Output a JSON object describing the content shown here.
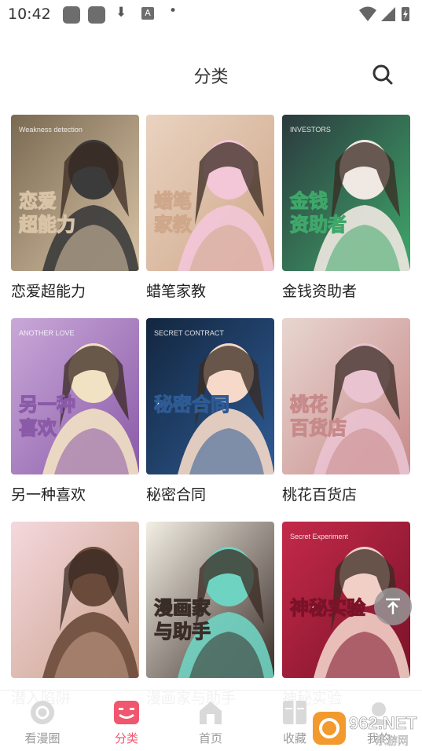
{
  "status_bar": {
    "time": "10:42",
    "download_glyph": "⬇",
    "a_glyph": "A",
    "dot_glyph": "•"
  },
  "header": {
    "title": "分类",
    "search_icon": "search-icon"
  },
  "comics": [
    {
      "title": "恋爱超能力",
      "cover_text": "恋爱\n超能力",
      "cover_sub": "Weakness detection",
      "colors": [
        "#7a6a52",
        "#d9c3a6",
        "#3b3b3b"
      ]
    },
    {
      "title": "蜡笔家教",
      "cover_text": "蜡笔\n家教",
      "cover_sub": "",
      "colors": [
        "#e9d3c0",
        "#cfa78a",
        "#f3c6d8"
      ]
    },
    {
      "title": "金钱资助者",
      "cover_text": "金钱\n资助者",
      "cover_sub": "INVESTORS",
      "colors": [
        "#2b3a3e",
        "#3fa76a",
        "#f0e8e2"
      ]
    },
    {
      "title": "另一种喜欢",
      "cover_text": "另一种\n喜欢",
      "cover_sub": "ANOTHER LOVE",
      "colors": [
        "#c9a8d8",
        "#8a5aa8",
        "#f2e2c4"
      ]
    },
    {
      "title": "秘密合同",
      "cover_text": "秘密合同",
      "cover_sub": "SECRET CONTRACT",
      "colors": [
        "#13263f",
        "#2e5b94",
        "#f6d9c8"
      ]
    },
    {
      "title": "桃花百货店",
      "cover_text": "桃花\n百货店",
      "cover_sub": "",
      "colors": [
        "#e8d6d0",
        "#c78a8a",
        "#eac3d1"
      ]
    },
    {
      "title": "潜入陷阱",
      "cover_text": "",
      "cover_sub": "",
      "colors": [
        "#f5d8de",
        "#c9a08a",
        "#6a4a3a"
      ]
    },
    {
      "title": "漫画家与助手",
      "cover_text": "漫画家\n与助手",
      "cover_sub": "",
      "colors": [
        "#f3efe4",
        "#3a2d28",
        "#6fd3c2"
      ]
    },
    {
      "title": "神秘实验",
      "cover_text": "神秘实验",
      "cover_sub": "Secret Experiment",
      "colors": [
        "#c42a4a",
        "#7a1228",
        "#f2cfc6"
      ]
    }
  ],
  "scroll_top": {
    "icon": "arrow-up-icon"
  },
  "bottom_nav": [
    {
      "label": "看漫圈",
      "icon": "circle-icon",
      "active": false
    },
    {
      "label": "分类",
      "icon": "category-icon",
      "active": true
    },
    {
      "label": "首页",
      "icon": "home-icon",
      "active": false
    },
    {
      "label": "收藏",
      "icon": "book-icon",
      "active": false
    },
    {
      "label": "我的",
      "icon": "profile-icon",
      "active": false
    }
  ],
  "watermark": {
    "text": "962.NET",
    "subtext": "乐游网"
  }
}
